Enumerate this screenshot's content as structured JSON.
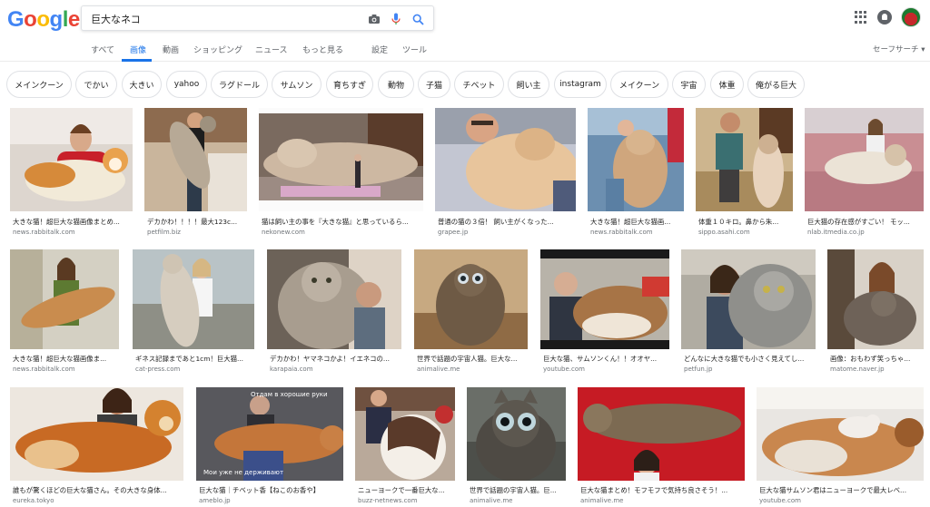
{
  "logo": {
    "text": "Google",
    "letters": [
      {
        "ch": "G",
        "color": "#4285f4"
      },
      {
        "ch": "o",
        "color": "#ea4335"
      },
      {
        "ch": "o",
        "color": "#fbbc05"
      },
      {
        "ch": "g",
        "color": "#4285f4"
      },
      {
        "ch": "l",
        "color": "#34a853"
      },
      {
        "ch": "e",
        "color": "#ea4335"
      }
    ]
  },
  "search": {
    "query": "巨大なネコ"
  },
  "icons": {
    "camera": "camera-icon",
    "mic": "microphone-icon",
    "search": "search-icon",
    "apps": "apps-grid-icon",
    "notifications": "notifications-icon",
    "account": "account-avatar"
  },
  "colors": {
    "accent": "#1a73e8",
    "mic_blue": "#4285f4",
    "text_secondary": "#70757a"
  },
  "tabs": [
    {
      "label": "すべて",
      "active": false
    },
    {
      "label": "画像",
      "active": true
    },
    {
      "label": "動画",
      "active": false
    },
    {
      "label": "ショッピング",
      "active": false
    },
    {
      "label": "ニュース",
      "active": false
    },
    {
      "label": "もっと見る",
      "active": false
    },
    {
      "label": "設定",
      "active": false
    },
    {
      "label": "ツール",
      "active": false
    }
  ],
  "safe_search": "セーフサーチ ▾",
  "chips": [
    "メインクーン",
    "でかい",
    "大きい",
    "yahoo",
    "ラグドール",
    "サムソン",
    "育ちすぎ",
    "動物",
    "子猫",
    "チベット",
    "飼い主",
    "instagram",
    "メイクーン",
    "宇宙",
    "体重",
    "俺がる巨大"
  ],
  "results": [
    {
      "title": "大きな猫！超巨大な猫画像まとめ...",
      "source": "news.rabbitalk.com"
    },
    {
      "title": "デカかわ！！！！最大123c...",
      "source": "petfilm.biz"
    },
    {
      "title": "猫は飼い主の事を『大きな猫』と思っているら...",
      "source": "nekonew.com"
    },
    {
      "title": "普通の猫の３倍！ 飼い主がくなった...",
      "source": "grapee.jp"
    },
    {
      "title": "大きな猫！超巨大な猫画...",
      "source": "news.rabbitalk.com"
    },
    {
      "title": "体重１０キロ。鼻から朱...",
      "source": "sippo.asahi.com"
    },
    {
      "title": "巨大猫の存在感がすごい！ モッ...",
      "source": "nlab.itmedia.co.jp"
    },
    {
      "title": "大きな猫！超巨大な猫画像ま...",
      "source": "news.rabbitalk.com"
    },
    {
      "title": "ギネス記録まであと1cm！巨大猫...",
      "source": "cat-press.com"
    },
    {
      "title": "デカかわ！ヤマネコかよ！イエネコの...",
      "source": "karapaia.com"
    },
    {
      "title": "世界で話題の宇宙人猫。巨大な...",
      "source": "animalive.me"
    },
    {
      "title": "巨大な猫、サムソンくん！！オオヤ...",
      "source": "youtube.com"
    },
    {
      "title": "どんなに大きな猫でも小さく見えてし...",
      "source": "petfun.jp"
    },
    {
      "title": "画像：おもわず笑っちゃ...",
      "source": "matome.naver.jp"
    },
    {
      "title": "誰もが驚くほどの巨大な猫さん。その大きな身体...",
      "source": "eureka.tokyo"
    },
    {
      "title": "巨大な猫｜チベット香【ねこのお香や】",
      "source": "ameblo.jp"
    },
    {
      "title": "ニューヨークで一番巨大な...",
      "source": "buzz-netnews.com"
    },
    {
      "title": "世界で話題の宇宙人猫。巨...",
      "source": "animalive.me"
    },
    {
      "title": "巨大な猫まとめ！モフモフで気持ち良さそう！...",
      "source": "animalive.me"
    },
    {
      "title": "巨大な猫サムソン君はニューヨークで最大レベ...",
      "source": "youtube.com"
    }
  ],
  "image_captions": {
    "r16_top": "Отдам в хорошие руки",
    "r16_bottom": "Мои уже не держивают"
  }
}
